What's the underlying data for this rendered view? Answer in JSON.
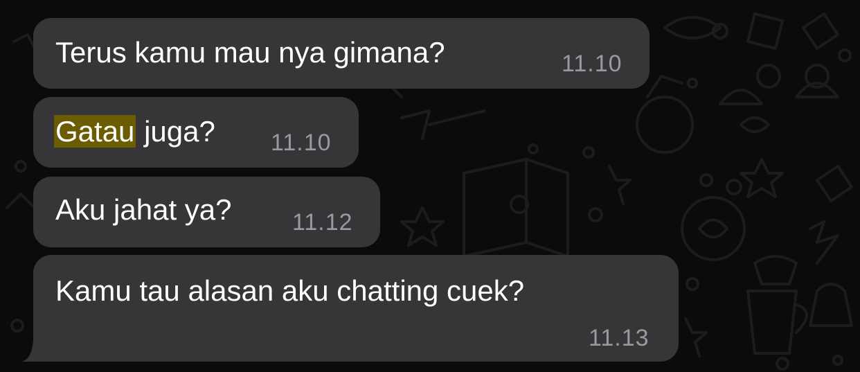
{
  "messages": [
    {
      "text_before": "Terus kamu mau nya gimana?",
      "highlight": "",
      "text_after": "",
      "time": "11.10"
    },
    {
      "text_before": "",
      "highlight": "Gatau",
      "text_after": " juga?",
      "time": "11.10"
    },
    {
      "text_before": "Aku jahat ya?",
      "highlight": "",
      "text_after": "",
      "time": "11.12"
    },
    {
      "text_before": "Kamu tau alasan aku chatting cuek?",
      "highlight": "",
      "text_after": "",
      "time": "11.13"
    }
  ],
  "colors": {
    "background": "#0b0b0b",
    "bubble": "#363638",
    "text": "#ffffff",
    "timestamp": "#9a9a9e",
    "highlight": "#6b5c00"
  },
  "wallpaper": "doodle-pattern"
}
